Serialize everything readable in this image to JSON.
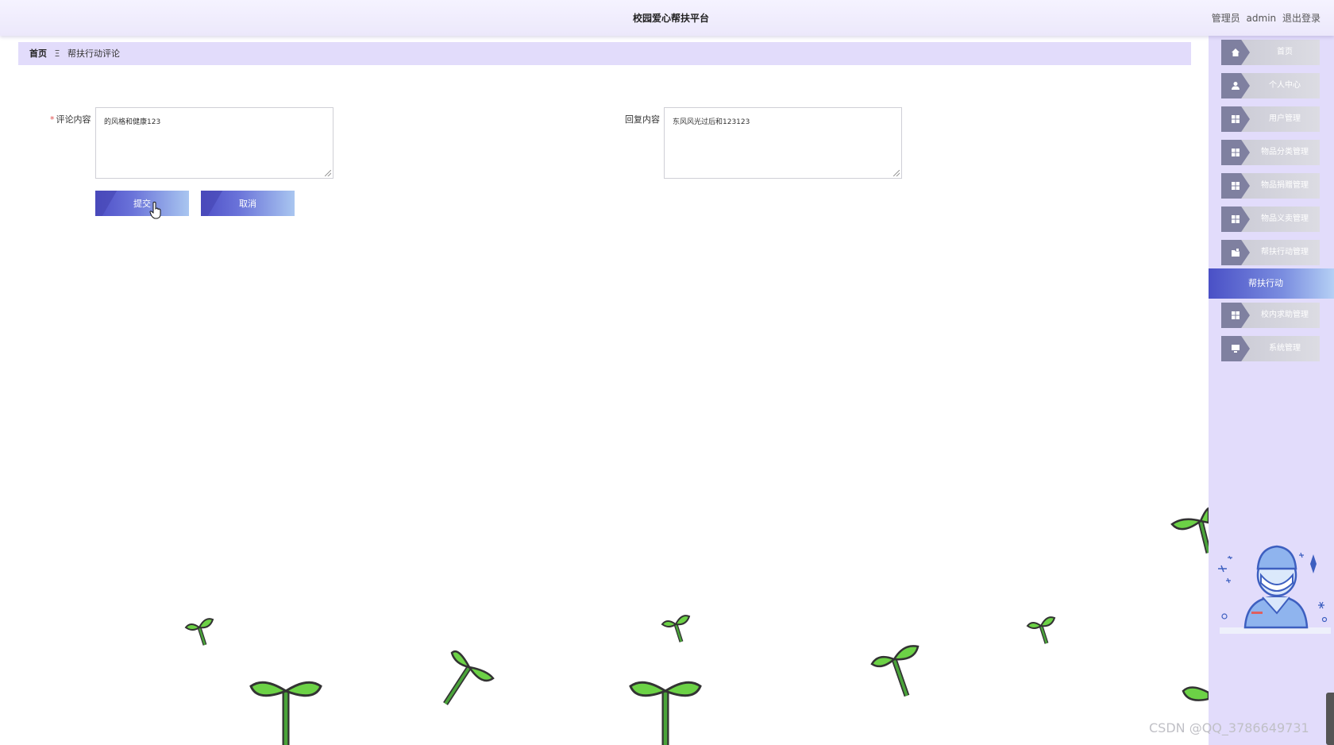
{
  "header": {
    "title": "校园爱心帮扶平台",
    "role": "管理员",
    "username": "admin",
    "logout_label": "退出登录"
  },
  "breadcrumb": {
    "home": "首页",
    "separator": "Ξ",
    "current": "帮扶行动评论"
  },
  "form": {
    "comment_label": "评论内容",
    "comment_required_mark": "*",
    "comment_value": "的风格和健康123",
    "reply_label": "回复内容",
    "reply_value": "东风风光过后和123123",
    "submit_label": "提交",
    "cancel_label": "取消"
  },
  "sidebar": {
    "items": [
      {
        "label": "首页",
        "icon": "home-icon"
      },
      {
        "label": "个人中心",
        "icon": "user-icon"
      },
      {
        "label": "用户管理",
        "icon": "grid-icon"
      },
      {
        "label": "物品分类管理",
        "icon": "grid-icon"
      },
      {
        "label": "物品捐赠管理",
        "icon": "grid-icon"
      },
      {
        "label": "物品义卖管理",
        "icon": "grid-icon"
      },
      {
        "label": "帮扶行动管理",
        "icon": "folder-icon"
      },
      {
        "label": "帮扶行动",
        "icon": "",
        "active": true
      },
      {
        "label": "校内求助管理",
        "icon": "grid-icon"
      },
      {
        "label": "系统管理",
        "icon": "monitor-icon"
      }
    ]
  },
  "watermark": "CSDN @QQ_3786649731",
  "colors": {
    "accent": "#4e4fc7",
    "sidebar_bg": "#e2dcfb",
    "breadcrumb_bg": "#e2dcfb",
    "sprout_green": "#6cd246"
  }
}
